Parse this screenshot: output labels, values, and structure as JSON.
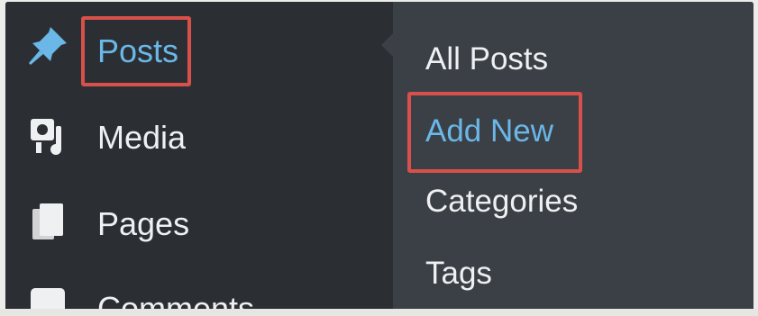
{
  "sidebar": {
    "items": [
      {
        "label": "Posts",
        "icon": "pushpin-icon",
        "active": true
      },
      {
        "label": "Media",
        "icon": "media-icon",
        "active": false
      },
      {
        "label": "Pages",
        "icon": "pages-icon",
        "active": false
      },
      {
        "label": "Comments",
        "icon": "comments-icon",
        "active": false
      }
    ]
  },
  "submenu": {
    "items": [
      {
        "label": "All Posts",
        "current": false
      },
      {
        "label": "Add New",
        "current": true
      },
      {
        "label": "Categories",
        "current": false
      },
      {
        "label": "Tags",
        "current": false
      }
    ]
  },
  "colors": {
    "sidebar_bg": "#2b2f34",
    "submenu_bg": "#3b4046",
    "active_text": "#6ab7e8",
    "text": "#eef0f2",
    "highlight_border": "#d8504a"
  }
}
